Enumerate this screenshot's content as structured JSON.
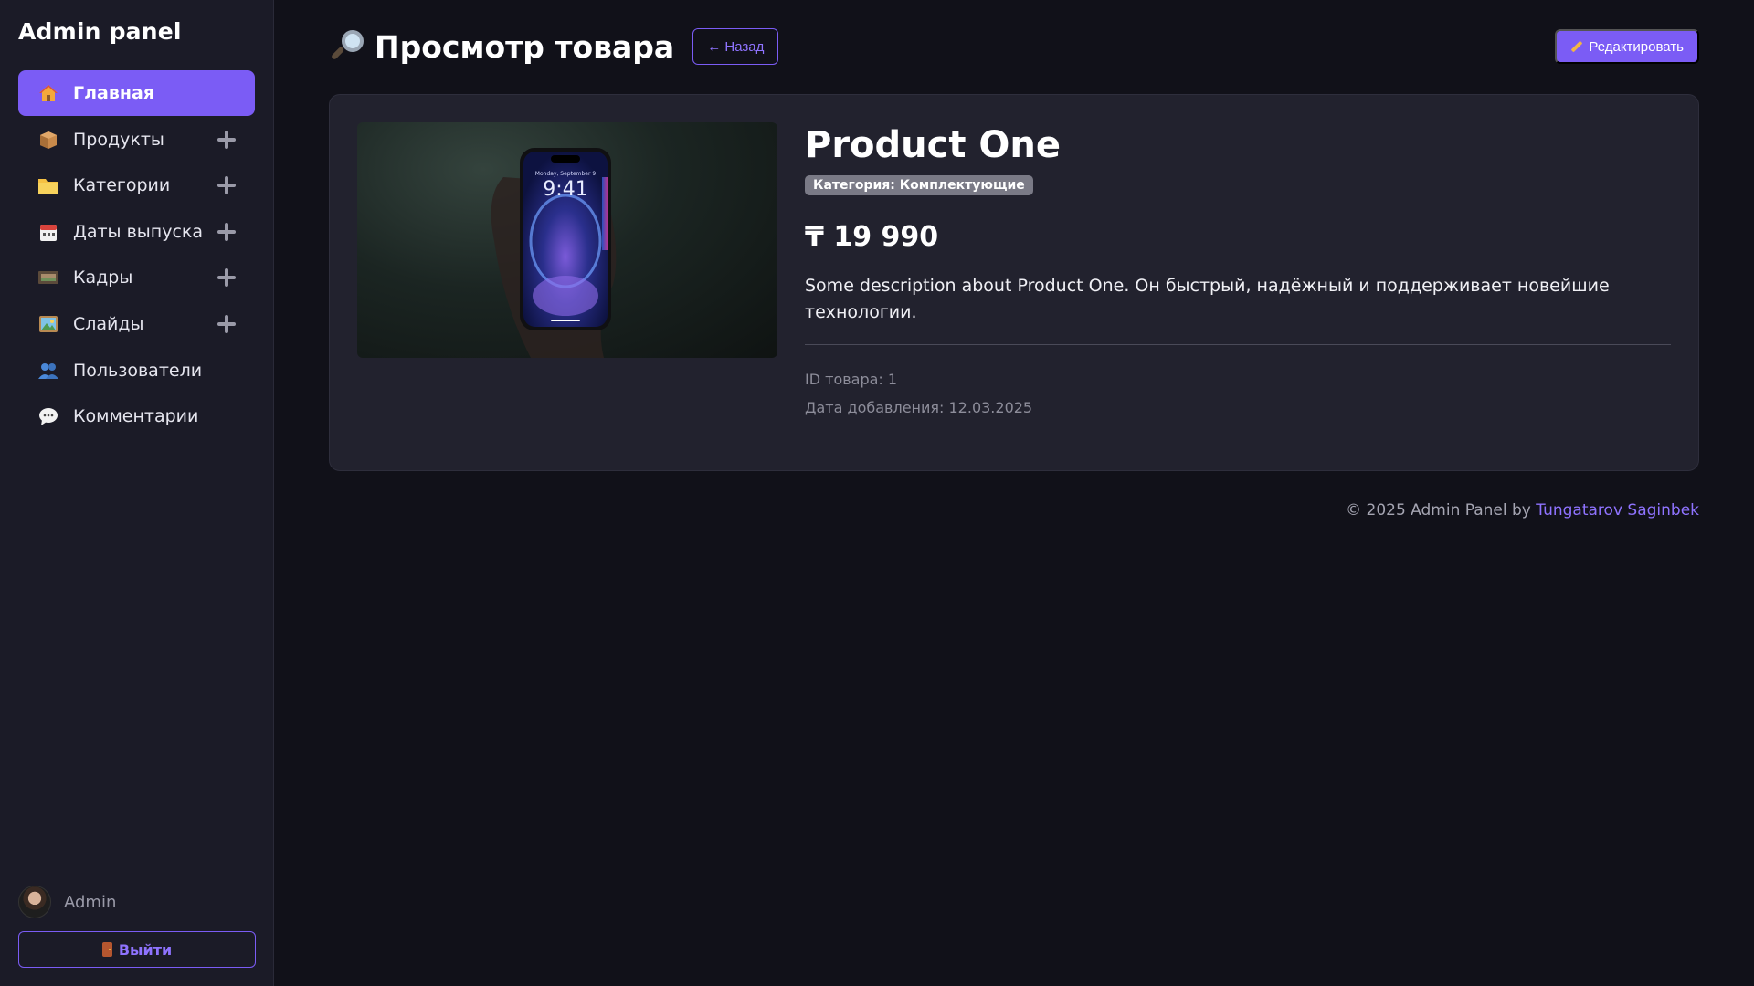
{
  "sidebar": {
    "brand": "Admin panel",
    "items": [
      {
        "label": "Главная",
        "icon": "home-icon",
        "active": true,
        "has_add": false
      },
      {
        "label": "Продукты",
        "icon": "package-icon",
        "active": false,
        "has_add": true
      },
      {
        "label": "Категории",
        "icon": "folder-icon",
        "active": false,
        "has_add": true
      },
      {
        "label": "Даты выпуска",
        "icon": "calendar-icon",
        "active": false,
        "has_add": true
      },
      {
        "label": "Кадры",
        "icon": "film-frames-icon",
        "active": false,
        "has_add": true
      },
      {
        "label": "Слайды",
        "icon": "picture-icon",
        "active": false,
        "has_add": true
      },
      {
        "label": "Пользователи",
        "icon": "users-icon",
        "active": false,
        "has_add": false
      },
      {
        "label": "Комментарии",
        "icon": "speech-bubble-icon",
        "active": false,
        "has_add": false
      }
    ],
    "user": {
      "name": "Admin"
    },
    "logout_label": "Выйти"
  },
  "header": {
    "title": "Просмотр товара",
    "back_label": "← Назад",
    "edit_label": "Редактировать"
  },
  "product": {
    "name": "Product One",
    "category": "Категория: Комплектующие",
    "price": "₸ 19 990",
    "description": "Some description about Product One. Он быстрый, надёжный и поддерживает новейшие технологии.",
    "id_text": "ID товара: 1",
    "date_text": "Дата добавления: 12.03.2025",
    "image": {
      "phone_time": "9:41",
      "phone_date": "Monday, September 9"
    }
  },
  "footer": {
    "copyright": "© 2025 Admin Panel by",
    "author": "Tungatarov Saginbek"
  },
  "colors": {
    "accent": "#7b5cf5",
    "background": "#111119",
    "sidebar": "#1b1b27",
    "card": "#22222e"
  }
}
